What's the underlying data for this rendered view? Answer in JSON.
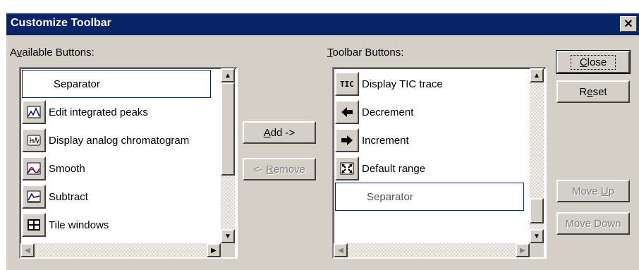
{
  "window": {
    "title": "Customize Toolbar",
    "close_glyph": "✕"
  },
  "available": {
    "label": "Available Buttons:",
    "items": [
      {
        "label": "Separator",
        "icon": "none",
        "selected": true
      },
      {
        "label": "Edit integrated peaks",
        "icon": "edit-peaks-icon"
      },
      {
        "label": "Display analog chromatogram",
        "icon": "analog-chromatogram-icon"
      },
      {
        "label": "Smooth",
        "icon": "smooth-icon"
      },
      {
        "label": "Subtract",
        "icon": "subtract-icon"
      },
      {
        "label": "Tile windows",
        "icon": "tile-windows-icon"
      }
    ]
  },
  "toolbar": {
    "label": "Toolbar Buttons:",
    "items": [
      {
        "label": "Display TIC trace",
        "icon": "tic-icon",
        "icon_text": "TIC"
      },
      {
        "label": "Decrement",
        "icon": "arrow-left-icon"
      },
      {
        "label": "Increment",
        "icon": "arrow-right-icon"
      },
      {
        "label": "Default range",
        "icon": "default-range-icon"
      },
      {
        "label": "Separator",
        "icon": "none",
        "selected": true
      }
    ]
  },
  "buttons": {
    "add": "Add ->",
    "remove": "<- Remove",
    "close": "Close",
    "reset": "Reset",
    "move_up": "Move Up",
    "move_down": "Move Down"
  },
  "scroll_glyphs": {
    "up": "▲",
    "down": "▼",
    "left": "◀",
    "right": "▶"
  }
}
